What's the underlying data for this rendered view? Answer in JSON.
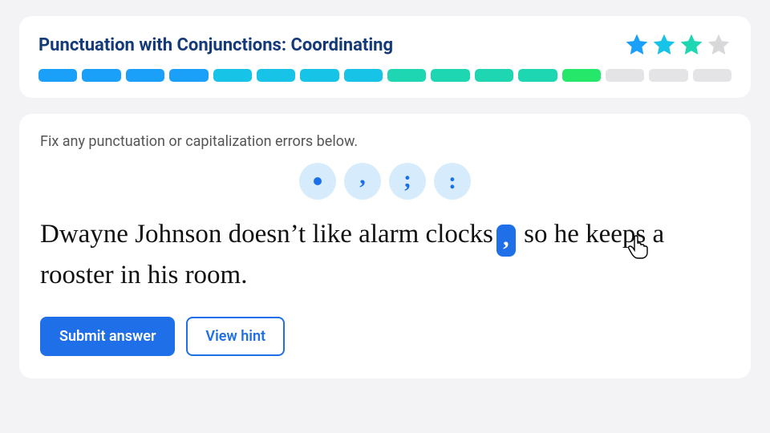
{
  "header": {
    "title": "Punctuation with Conjunctions: Coordinating",
    "stars": {
      "total": 4,
      "colors": [
        "#1aa0f8",
        "#17c4e8",
        "#1fd6b3",
        "#d8d8db"
      ]
    },
    "segments": [
      "#1aa0f8",
      "#1aa0f8",
      "#1aa0f8",
      "#1aa0f8",
      "#17c4e8",
      "#17c4e8",
      "#17c4e8",
      "#17c4e8",
      "#1fd6b3",
      "#1fd6b3",
      "#1fd6b3",
      "#1fd6b3",
      "#25e86a",
      "#e4e4e7",
      "#e4e4e7",
      "#e4e4e7"
    ]
  },
  "question": {
    "instruction": "Fix any punctuation or capitalization errors below.",
    "punct_options": [
      {
        "name": "period",
        "glyph": "."
      },
      {
        "name": "comma",
        "glyph": ","
      },
      {
        "name": "semicolon",
        "glyph": ";"
      },
      {
        "name": "colon",
        "glyph": ":"
      }
    ],
    "sentence_pre": "Dwayne Johnson doesn’t like alarm clocks",
    "inserted": ",",
    "sentence_post": " so he keeps a rooster in his room."
  },
  "buttons": {
    "submit": "Submit answer",
    "hint": "View hint"
  }
}
